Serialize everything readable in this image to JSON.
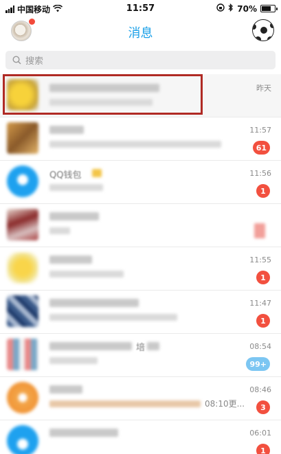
{
  "status_bar": {
    "carrier": "中国移动",
    "time": "11:57",
    "battery": "70%",
    "battery_level": 0.7
  },
  "nav": {
    "title": "消息"
  },
  "search": {
    "placeholder": "搜索"
  },
  "conversations": [
    {
      "time": "昨天",
      "badge": ""
    },
    {
      "time": "11:57",
      "badge": "61"
    },
    {
      "time": "11:56",
      "badge": "1",
      "name_fragment": "QQ钱包"
    },
    {
      "time": "",
      "badge": ""
    },
    {
      "time": "11:55",
      "badge": "1"
    },
    {
      "time": "11:47",
      "badge": "1"
    },
    {
      "time": "08:54",
      "badge": "99+",
      "name_fragment": "培"
    },
    {
      "time": "08:46",
      "badge": "3",
      "preview_fragment": "08:10更..."
    },
    {
      "time": "06:01",
      "badge": "1"
    }
  ]
}
